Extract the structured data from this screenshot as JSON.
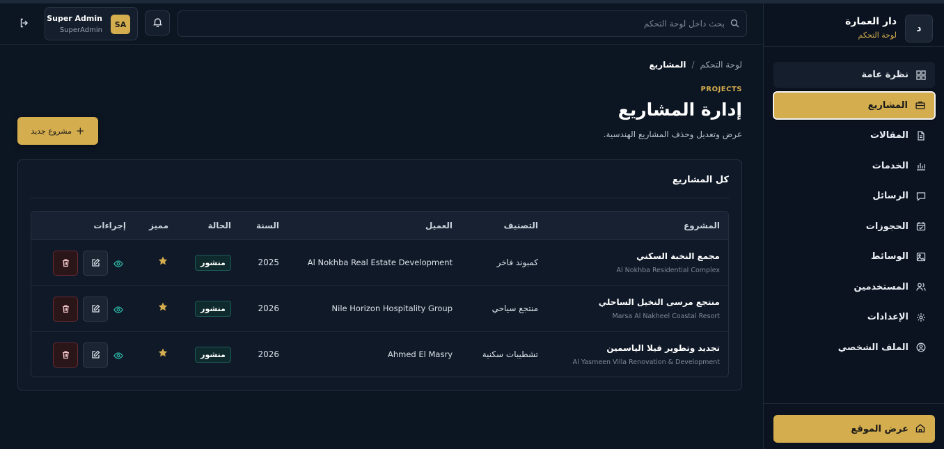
{
  "sidebar": {
    "brand_logo_letter": "د",
    "brand_name": "دار العمارة",
    "brand_subtitle": "لوحة التحكم",
    "items": [
      {
        "label": "نظرة عامة",
        "icon": "grid-icon"
      },
      {
        "label": "المشاريع",
        "icon": "briefcase-icon",
        "active": true
      },
      {
        "label": "المقالات",
        "icon": "document-icon"
      },
      {
        "label": "الخدمات",
        "icon": "bar-chart-icon"
      },
      {
        "label": "الرسائل",
        "icon": "message-icon"
      },
      {
        "label": "الحجوزات",
        "icon": "calendar-check-icon"
      },
      {
        "label": "الوسائط",
        "icon": "image-icon"
      },
      {
        "label": "المستخدمين",
        "icon": "users-icon"
      },
      {
        "label": "الإعدادات",
        "icon": "gear-icon"
      },
      {
        "label": "الملف الشخصي",
        "icon": "user-circle-icon"
      }
    ],
    "view_site_label": "عرض الموقع"
  },
  "header": {
    "search_placeholder": "بحث داخل لوحة التحكم",
    "user_name": "Super Admin",
    "user_role": "SuperAdmin",
    "user_initials": "SA"
  },
  "main": {
    "breadcrumb": {
      "root": "لوحة التحكم",
      "separator": "/",
      "current": "المشاريع"
    },
    "eyebrow": "PROJECTS",
    "title": "إدارة المشاريع",
    "description": "عرض وتعديل وحذف المشاريع الهندسية.",
    "new_button_label": "مشروع جديد",
    "card_title": "كل المشاريع",
    "table": {
      "headers": {
        "project": "المشروع",
        "category": "التصنيف",
        "client": "العميل",
        "year": "السنة",
        "status": "الحالة",
        "featured": "مميز",
        "actions": "إجراءات"
      },
      "rows": [
        {
          "name_ar": "مجمع النخبة السكني",
          "name_en": "Al Nokhba Residential Complex",
          "category": "كمبوند فاخر",
          "client": "Al Nokhba Real Estate Development",
          "year": "2025",
          "status": "منشور",
          "featured": true
        },
        {
          "name_ar": "منتجع مرسى النخيل الساحلي",
          "name_en": "Marsa Al Nakheel Coastal Resort",
          "category": "منتجع سياحي",
          "client": "Nile Horizon Hospitality Group",
          "year": "2026",
          "status": "منشور",
          "featured": true
        },
        {
          "name_ar": "تجديد وتطوير فيلا الياسمين",
          "name_en": "Al Yasmeen Villa Renovation & Development",
          "category": "تشطيبات سكنية",
          "client": "Ahmed El Masry",
          "year": "2026",
          "status": "منشور",
          "featured": true
        }
      ]
    }
  },
  "colors": {
    "accent": "#d4ad4e",
    "background": "#0c1522",
    "card": "#0f1928",
    "status_published": "#1d5a58",
    "danger": "#6a2a30"
  }
}
